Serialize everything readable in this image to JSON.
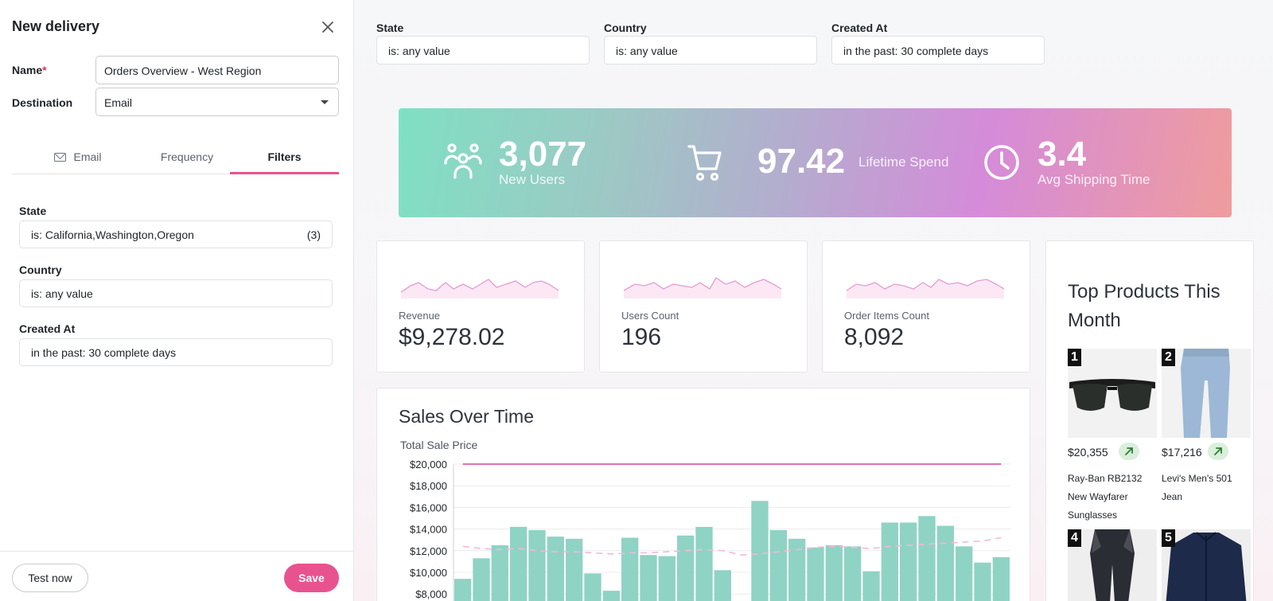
{
  "panel": {
    "title": "New delivery",
    "name_label": "Name",
    "name_required": "*",
    "name_value": "Orders Overview - West Region",
    "destination_label": "Destination",
    "destination_value": "Email",
    "tabs": [
      {
        "label": "Email",
        "icon": "mail-icon"
      },
      {
        "label": "Frequency"
      },
      {
        "label": "Filters",
        "active": true
      }
    ],
    "filters": [
      {
        "label": "State",
        "value": "is: California,Washington,Oregon",
        "count": "(3)"
      },
      {
        "label": "Country",
        "value": "is: any value"
      },
      {
        "label": "Created At",
        "value": "in the past: 30 complete days"
      }
    ],
    "test_button": "Test now",
    "save_button": "Save"
  },
  "dashboard": {
    "filters": [
      {
        "label": "State",
        "value": "is: any value"
      },
      {
        "label": "Country",
        "value": "is: any value"
      },
      {
        "label": "Created At",
        "value": "in the past: 30 complete days"
      }
    ],
    "banner": {
      "users_value": "3,077",
      "users_label": "New Users",
      "spend_value": "97.42",
      "spend_label": "Lifetime Spend",
      "ship_value": "3.4",
      "ship_label": "Avg Shipping Time"
    },
    "kpis": [
      {
        "label": "Revenue",
        "value": "$9,278.02"
      },
      {
        "label": "Users Count",
        "value": "196"
      },
      {
        "label": "Order Items Count",
        "value": "8,092"
      }
    ],
    "sales_title": "Sales Over Time",
    "top_products": {
      "title": "Top Products This Month",
      "items": [
        {
          "rank": "1",
          "price": "$20,355",
          "name": "Ray-Ban RB2132 New Wayfarer Sunglasses"
        },
        {
          "rank": "2",
          "price": "$17,216",
          "name": "Levi's Men's 501 Jean"
        },
        {
          "rank": "4"
        },
        {
          "rank": "5"
        }
      ]
    }
  },
  "colors": {
    "accent": "#e8538f",
    "bar": "#8fd3c5",
    "line": "#e36fb3"
  },
  "chart_data": {
    "type": "bar",
    "title": "Sales Over Time",
    "ylabel": "Total Sale Price",
    "yticks": [
      "$20,000",
      "$18,000",
      "$16,000",
      "$14,000",
      "$12,000",
      "$10,000",
      "$8,000"
    ],
    "ylim": [
      8000,
      20000
    ],
    "grid": true,
    "series": [
      {
        "values": [
          9400,
          11300,
          12500,
          14200,
          13900,
          13300,
          13100,
          9900,
          8300,
          13200,
          11600,
          11500,
          13400,
          14200,
          10200,
          7000,
          16600,
          13900,
          13100,
          12300,
          12500,
          12400,
          10100,
          14600,
          14600,
          15200,
          14300,
          12400,
          10900,
          11400
        ]
      },
      {
        "type": "line",
        "style": "dashed",
        "values": [
          12400,
          12200,
          12100,
          12200,
          12000,
          11900,
          11900,
          11800,
          11700,
          11800,
          11800,
          11900,
          12000,
          12100,
          12000,
          11600,
          11700,
          11900,
          12100,
          12300,
          12400,
          12300,
          12200,
          12400,
          12500,
          12600,
          12700,
          12800,
          12900,
          13200
        ]
      },
      {
        "type": "line",
        "values": [
          20000,
          20000,
          20000,
          20000,
          20000,
          20000,
          20000,
          20000,
          20000,
          20000,
          20000,
          20000,
          20000,
          20000,
          20000,
          20000,
          20000,
          20000,
          20000,
          20000,
          20000,
          20000,
          20000,
          20000,
          20000,
          20000,
          20000,
          20000,
          20000,
          20000
        ]
      }
    ]
  }
}
